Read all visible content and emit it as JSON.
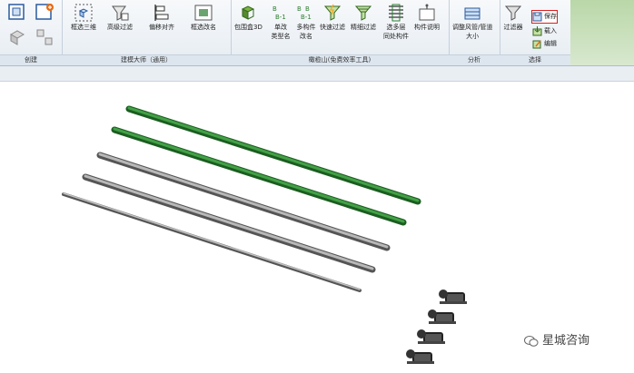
{
  "ribbon": {
    "groups": {
      "create": "创建",
      "master": "建模大师（通用）",
      "plugin": "橄榄山(免费效率工具)",
      "analysis": "分析",
      "select": "选择"
    },
    "tools": {
      "frame_3d": "框选三维",
      "advanced_filter": "高级过滤",
      "move_align": "偏移对齐",
      "rename": "框选改名",
      "bbox3d": "包围盒3D",
      "type_rename_1": "单改",
      "type_rename_2": "类型名",
      "multi_rename_1": "多构件",
      "multi_rename_2": "改名",
      "quick_filter": "快速过滤",
      "fine_filter": "精细过滤",
      "multi_layer_1": "选多层",
      "multi_layer_2": "同处构件",
      "component_info": "构件说明",
      "duct_size_1": "调整风管/管道",
      "duct_size_2": "大小",
      "filter": "过滤器",
      "save": "保存",
      "load": "载入",
      "edit": "编辑"
    }
  },
  "watermark": {
    "text": "星城咨询"
  },
  "colors": {
    "green_pipe": "#2e7d32",
    "gray_pipe": "#8a8a8a",
    "highlight": "#d92020"
  }
}
